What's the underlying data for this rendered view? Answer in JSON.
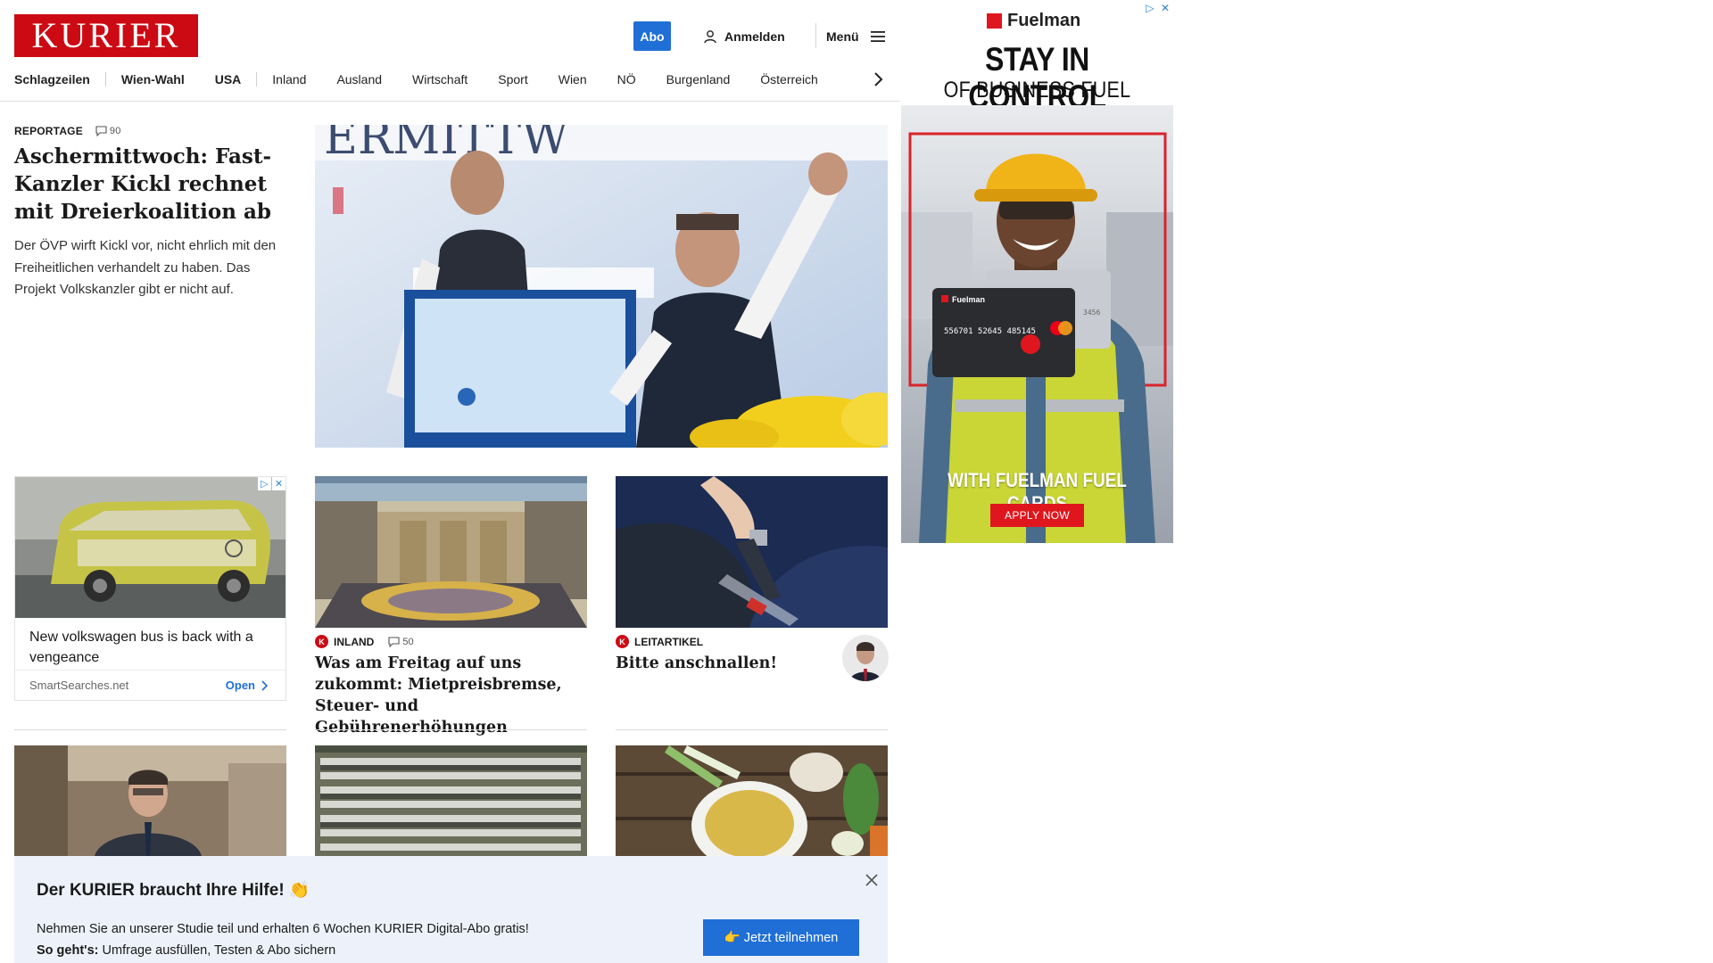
{
  "header": {
    "logo_text": "KURIER",
    "abo_label": "Abo",
    "login_label": "Anmelden",
    "menu_label": "Menü"
  },
  "nav": {
    "items": [
      {
        "label": "Schlagzeilen"
      },
      {
        "label": "Wien-Wahl"
      },
      {
        "label": "USA"
      },
      {
        "label": "Inland"
      },
      {
        "label": "Ausland"
      },
      {
        "label": "Wirtschaft"
      },
      {
        "label": "Sport"
      },
      {
        "label": "Wien"
      },
      {
        "label": "NÖ"
      },
      {
        "label": "Burgenland"
      },
      {
        "label": "Österreich"
      }
    ]
  },
  "lead": {
    "kicker": "REPORTAGE",
    "comments": "90",
    "title": "Aschermittwoch: Fast-Kanzler Kickl rechnet mit Dreierkoalition ab",
    "teaser": "Der ÖVP wirft Kickl vor, nicht ehrlich mit den Freiheitlichen verhandelt zu haben. Das Projekt Volkskanzler gibt er nicht auf."
  },
  "ad_card": {
    "title": "New volkswagen bus is back with a vengeance",
    "source": "SmartSearches.net",
    "open_label": "Open"
  },
  "cards": [
    {
      "kicker": "INLAND",
      "badge": "K",
      "comments": "50",
      "title": "Was am Freitag auf uns zukommt: Mietpreisbremse, Steuer- und Gebührenerhöhungen"
    },
    {
      "kicker": "LEITARTIKEL",
      "badge": "K",
      "title": "Bitte anschnallen!"
    }
  ],
  "survey": {
    "title": "Der KURIER braucht Ihre Hilfe! 👏",
    "line1": "Nehmen Sie an unserer Studie teil und erhalten 6 Wochen KURIER Digital-Abo gratis!",
    "line2_bold": "So geht's:",
    "line2_rest": " Umfrage ausfüllen, Testen & Abo sichern",
    "button_label": "👉 Jetzt teilnehmen"
  },
  "fuel_ad": {
    "brand": "Fuelman",
    "headline": "STAY IN CONTROL",
    "subheadline": "OF BUSINESS FUEL COSTS",
    "card_number": "556701 52645 485145",
    "card_last": "3456",
    "card_brand": "Fuelman",
    "cta_text": "WITH FUELMAN FUEL CARDS",
    "button_label": "APPLY NOW"
  },
  "colors": {
    "brand_red": "#cc0a14",
    "link_blue": "#1f6fd6",
    "survey_bg": "#edf2fa",
    "fuel_red": "#e0161e"
  }
}
